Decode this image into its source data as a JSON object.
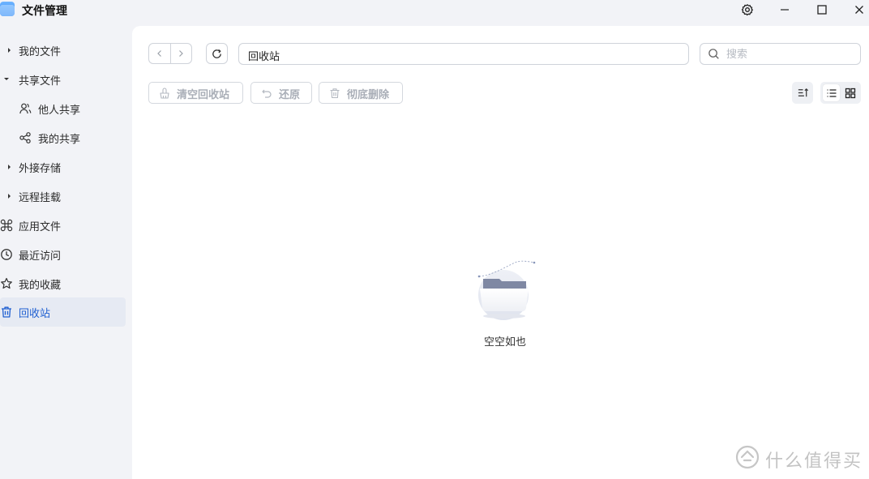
{
  "app": {
    "title": "文件管理"
  },
  "sidebar": {
    "items": [
      {
        "label": "我的文件"
      },
      {
        "label": "共享文件"
      },
      {
        "label": "他人共享"
      },
      {
        "label": "我的共享"
      },
      {
        "label": "外接存储"
      },
      {
        "label": "远程挂载"
      },
      {
        "label": "应用文件"
      },
      {
        "label": "最近访问"
      },
      {
        "label": "我的收藏"
      },
      {
        "label": "回收站"
      }
    ]
  },
  "toolbar": {
    "path": "回收站",
    "search_placeholder": "搜索",
    "empty_trash_label": "清空回收站",
    "restore_label": "还原",
    "delete_forever_label": "彻底删除"
  },
  "content": {
    "empty_text": "空空如也"
  },
  "watermark": {
    "text": "什么值得买"
  },
  "colors": {
    "accent": "#1f5fd1",
    "active_bg": "#e6eaf3",
    "sidebar_bg": "#f2f3f7",
    "disabled_text": "#a9aeb7"
  }
}
